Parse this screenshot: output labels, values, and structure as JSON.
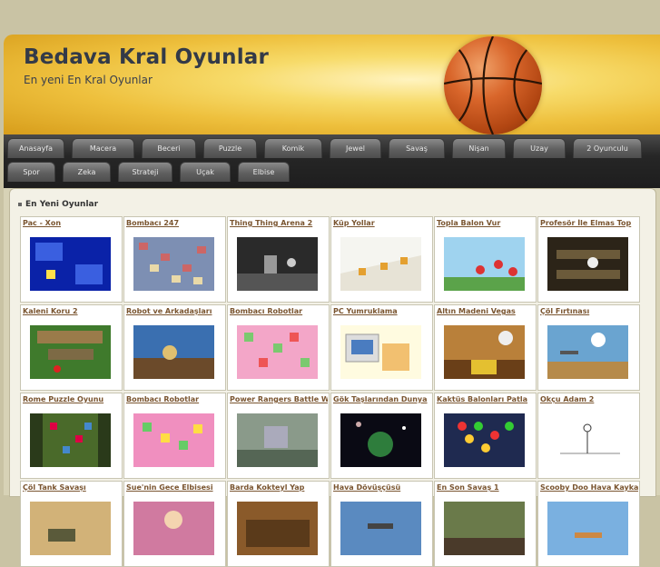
{
  "site": {
    "title": "Bedava Kral Oyunlar",
    "subtitle": "En yeni En Kral Oyunlar"
  },
  "nav": {
    "row1": [
      "Anasayfa",
      "Macera",
      "Beceri",
      "Puzzle",
      "Komik",
      "Jewel",
      "Savaş",
      "Nişan",
      "Uzay",
      "2 Oyunculu"
    ],
    "row2": [
      "Spor",
      "Zeka",
      "Strateji",
      "Uçak",
      "Elbise"
    ]
  },
  "section": {
    "title": "En Yeni Oyunlar"
  },
  "games": [
    {
      "name": "Pac - Xon",
      "thumb": "pac-xon-thumbnail"
    },
    {
      "name": "Bombacı 247",
      "thumb": "bombaci-247-thumbnail"
    },
    {
      "name": "Thing Thing Arena 2",
      "thumb": "thing-thing-arena-thumbnail"
    },
    {
      "name": "Küp Yollar",
      "thumb": "kup-yollar-thumbnail"
    },
    {
      "name": "Topla Balon Vur",
      "thumb": "topla-balon-vur-thumbnail"
    },
    {
      "name": "Profesör İle Elmas Top",
      "thumb": "profesor-elmas-thumbnail"
    },
    {
      "name": "Kaleni Koru 2",
      "thumb": "kaleni-koru-thumbnail"
    },
    {
      "name": "Robot ve Arkadaşları",
      "thumb": "robot-arkadaslari-thumbnail"
    },
    {
      "name": "Bombacı Robotlar",
      "thumb": "bombaci-robotlar-thumbnail"
    },
    {
      "name": "PC Yumruklama",
      "thumb": "pc-yumruklama-thumbnail"
    },
    {
      "name": "Altın Madeni Vegas",
      "thumb": "altin-madeni-thumbnail"
    },
    {
      "name": "Çöl Fırtınası",
      "thumb": "col-firtinasi-thumbnail"
    },
    {
      "name": "Rome Puzzle Oyunu",
      "thumb": "rome-puzzle-thumbnail"
    },
    {
      "name": "Bombacı Robotlar",
      "thumb": "bombaci-robotlar-2-thumbnail"
    },
    {
      "name": "Power Rangers Battle Wor",
      "thumb": "power-rangers-thumbnail"
    },
    {
      "name": "Gök Taşlarından Dunya",
      "thumb": "gok-taslari-thumbnail"
    },
    {
      "name": "Kaktüs Balonları Patla",
      "thumb": "kaktus-balonlari-thumbnail"
    },
    {
      "name": "Okçu Adam 2",
      "thumb": "okcu-adam-thumbnail"
    },
    {
      "name": "Çöl Tank Savaşı",
      "thumb": "col-tank-thumbnail"
    },
    {
      "name": "Sue'nin Gece Elbisesi",
      "thumb": "sue-elbise-thumbnail"
    },
    {
      "name": "Barda Kokteyl Yap",
      "thumb": "barda-kokteyl-thumbnail"
    },
    {
      "name": "Hava Dövüşçüsü",
      "thumb": "hava-dovuscusu-thumbnail"
    },
    {
      "name": "En Son Savaş 1",
      "thumb": "en-son-savas-thumbnail"
    },
    {
      "name": "Scooby Doo Hava Kaykayı",
      "thumb": "scooby-doo-thumbnail"
    }
  ]
}
